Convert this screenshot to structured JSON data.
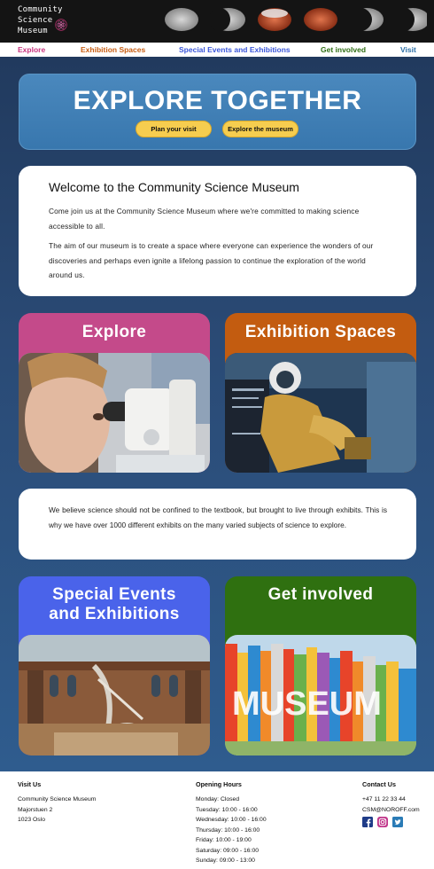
{
  "header": {
    "logo_lines": [
      "Community",
      "Science",
      "Museum"
    ],
    "logo_icon": "atom-icon"
  },
  "nav": [
    {
      "label": "Explore",
      "color": "#c8357f"
    },
    {
      "label": "Exhibition Spaces",
      "color": "#c75d12"
    },
    {
      "label": "Special Events and Exhibitions",
      "color": "#3a56d9"
    },
    {
      "label": "Get involved",
      "color": "#2e6d12"
    },
    {
      "label": "Visit",
      "color": "#2c6fa6"
    }
  ],
  "hero": {
    "title": "EXPLORE TOGETHER",
    "plan_button": "Plan your visit",
    "explore_button": "Explore the museum"
  },
  "welcome": {
    "title": "Welcome to the Community Science Museum",
    "p1": "Come join us at the Community Science Museum where we're committed to making science accessible to all.",
    "p2": "The aim of our museum is to create a space where everyone can experience the wonders of our discoveries and perhaps even ignite a lifelong passion to continue the exploration of the world around us."
  },
  "tiles": {
    "explore": {
      "title": "Explore",
      "color": "#c44a8a"
    },
    "exhibition": {
      "title": "Exhibition Spaces",
      "color": "#c35c10"
    },
    "events": {
      "title_line1": "Special Events",
      "title_line2": "and Exhibitions",
      "color": "#4a63ea"
    },
    "involved": {
      "title": "Get involved",
      "color": "#2f7010"
    }
  },
  "believe": {
    "text": "We believe science should not be confined to the textbook, but brought to live through exhibits. This is why we have over 1000 different exhibits on the many varied subjects of science to explore."
  },
  "footer": {
    "visit": {
      "heading": "Visit Us",
      "lines": [
        "Community Science Museum",
        "Majorstuen 2",
        "1023 Oslo"
      ]
    },
    "hours": {
      "heading": "Opening Hours",
      "lines": [
        "Monday: Closed",
        "Tuesday: 10:00 - 16:00",
        "Wednesday: 10:00 - 16:00",
        "Thursday: 10:00 - 16:00",
        "Friday: 10:00 - 19:00",
        "Saturday: 09:00 - 16:00",
        "Sunday: 09:00 - 13:00"
      ]
    },
    "contact": {
      "heading": "Contact Us",
      "phone": "+47 11 22 33 44",
      "email": "CSM@NOROFF.com",
      "social_icons": [
        "facebook-icon",
        "instagram-icon",
        "twitter-icon"
      ]
    }
  }
}
